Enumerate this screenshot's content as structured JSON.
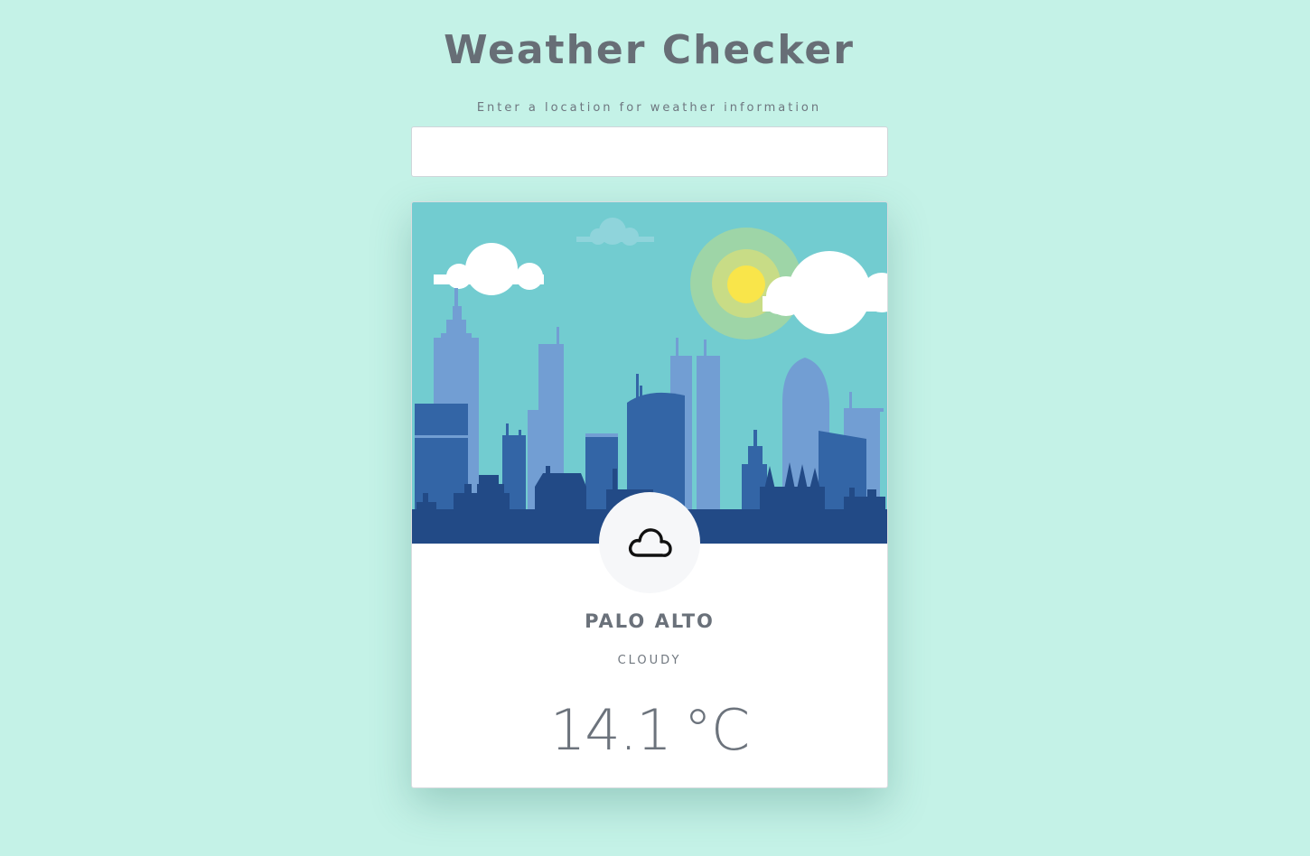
{
  "app": {
    "title": "Weather Checker",
    "subtitle": "Enter a location for weather information"
  },
  "search": {
    "value": "",
    "placeholder": ""
  },
  "weather": {
    "city": "PALO ALTO",
    "condition": "CLOUDY",
    "temperature": "14.1",
    "unit": "°C",
    "icon": "cloud-icon"
  },
  "colors": {
    "background": "#c4f2e7",
    "sky": "#72ccd0",
    "sun": "#f9e54a",
    "building_light": "#729ed3",
    "building_mid": "#3365a6",
    "building_dark": "#224a86"
  }
}
